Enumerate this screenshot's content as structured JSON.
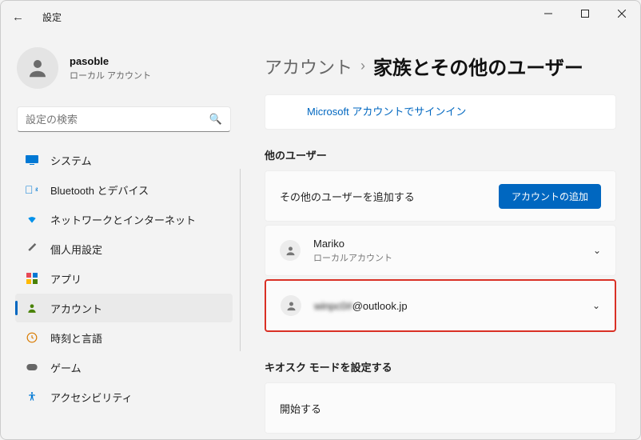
{
  "window": {
    "title": "設定"
  },
  "user": {
    "name": "pasoble",
    "sub": "ローカル アカウント"
  },
  "search": {
    "placeholder": "設定の検索"
  },
  "nav": {
    "items": [
      {
        "label": "システム"
      },
      {
        "label": "Bluetooth とデバイス"
      },
      {
        "label": "ネットワークとインターネット"
      },
      {
        "label": "個人用設定"
      },
      {
        "label": "アプリ"
      },
      {
        "label": "アカウント"
      },
      {
        "label": "時刻と言語"
      },
      {
        "label": "ゲーム"
      },
      {
        "label": "アクセシビリティ"
      }
    ]
  },
  "breadcrumb": {
    "parent": "アカウント",
    "current": "家族とその他のユーザー"
  },
  "msLink": "Microsoft アカウントでサインイン",
  "otherUsers": {
    "title": "他のユーザー",
    "addRow": "その他のユーザーを追加する",
    "addBtn": "アカウントの追加",
    "users": [
      {
        "name": "Mariko",
        "sub": "ローカルアカウント"
      },
      {
        "emailPrefix": "winpc0#",
        "emailSuffix": "@outlook.jp"
      }
    ]
  },
  "kiosk": {
    "title": "キオスク モードを設定する",
    "start": "開始する"
  }
}
